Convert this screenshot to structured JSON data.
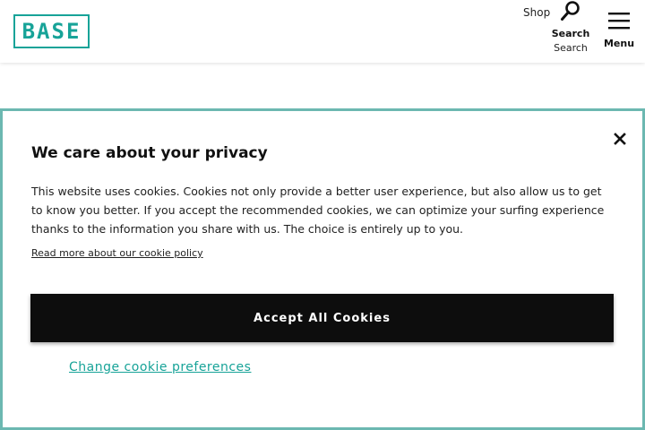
{
  "header": {
    "logo_text": "BASE",
    "shop_label": "Shop",
    "search_label": "Search",
    "search_sublabel": "Search",
    "menu_label": "Menu"
  },
  "icons": {
    "search": "search-icon",
    "menu": "hamburger-menu-icon",
    "close": "close-icon"
  },
  "dialog": {
    "title": "We care about your privacy",
    "body": "This website uses cookies. Cookies not only provide a better user experience, but also allow us to get to know you better. If you accept the recommended cookies, we can optimize your surfing experience thanks to the information you share with us. The choice is entirely up to you.",
    "policy_link": "Read more about our cookie policy",
    "accept_label": "Accept All Cookies",
    "preferences_label": "Change cookie preferences"
  },
  "colors": {
    "brand": "#17a398",
    "dialog_border": "#6cb8b1",
    "button_bg": "#0d0d0d"
  }
}
